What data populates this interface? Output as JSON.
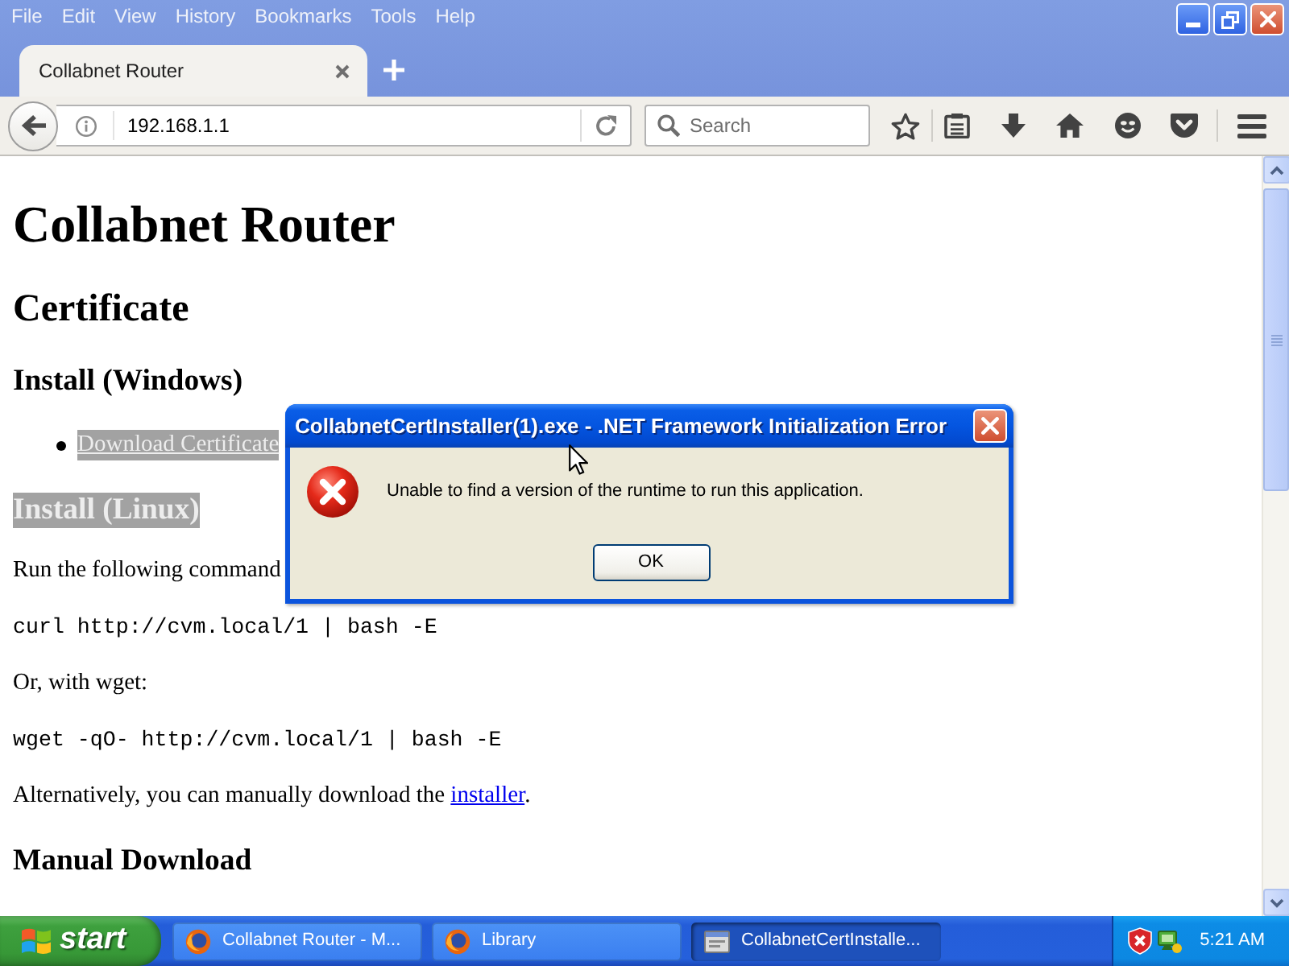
{
  "menu_bar": {
    "items": [
      "File",
      "Edit",
      "View",
      "History",
      "Bookmarks",
      "Tools",
      "Help"
    ]
  },
  "tabs": [
    {
      "label": "Collabnet Router",
      "selected": true
    }
  ],
  "toolbar": {
    "address": "192.168.1.1",
    "search_placeholder": "Search"
  },
  "page": {
    "blocks": [
      {
        "kind": "h1",
        "text": "Collabnet Router",
        "highlighted": false
      },
      {
        "kind": "h2",
        "text": "Certificate",
        "highlighted": false
      },
      {
        "kind": "h3",
        "text": "Install (Windows)",
        "highlighted": false
      },
      {
        "kind": "bullet_link",
        "text": "Download Certificate",
        "highlighted": true
      },
      {
        "kind": "h3",
        "text": "Install (Linux)",
        "highlighted": true
      },
      {
        "kind": "para",
        "text": "Run the following command",
        "highlighted": false
      },
      {
        "kind": "code",
        "text": "curl http://cvm.local/1 | bash -E",
        "highlighted": false
      },
      {
        "kind": "para",
        "text": "Or, with wget:",
        "highlighted": false
      },
      {
        "kind": "code",
        "text": "wget -qO- http://cvm.local/1 | bash -E",
        "highlighted": false
      },
      {
        "kind": "para",
        "text": "Alternatively, you can manually download the ",
        "link": "installer",
        "after": ".",
        "highlighted": false
      },
      {
        "kind": "h3",
        "text": "Manual Download",
        "highlighted": false
      }
    ]
  },
  "dialog": {
    "title": "CollabnetCertInstaller(1).exe - .NET Framework Initialization Error",
    "message": "Unable to find a version of the runtime to run this application.",
    "buttons": [
      "OK"
    ]
  },
  "taskbar": {
    "start": "start",
    "tasks": [
      {
        "kind": "browser",
        "label": "Collabnet Router - M...",
        "selected": false
      },
      {
        "kind": "browser",
        "label": "Library",
        "selected": false
      },
      {
        "kind": "installer",
        "label": "CollabnetCertInstalle...",
        "selected": true
      }
    ],
    "clock": "5:21 AM"
  }
}
